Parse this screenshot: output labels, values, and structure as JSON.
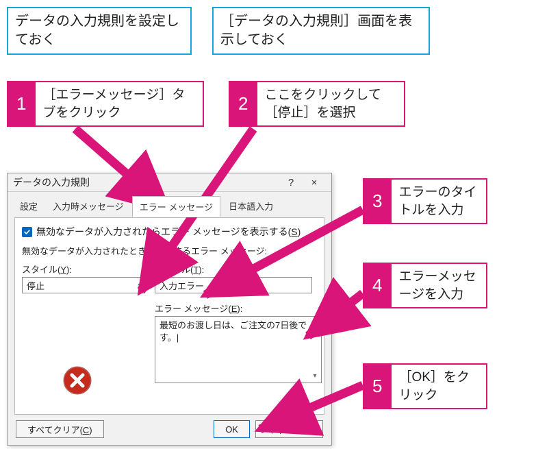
{
  "intro": {
    "box1": "データの入力規則を設定しておく",
    "box2": "［データの入力規則］画面を表示しておく"
  },
  "steps": {
    "s1": {
      "num": "1",
      "text": "［エラーメッセージ］タブをクリック"
    },
    "s2": {
      "num": "2",
      "text": "ここをクリックして［停止］を選択"
    },
    "s3": {
      "num": "3",
      "text": "エラーのタイトルを入力"
    },
    "s4": {
      "num": "4",
      "text": "エラーメッセージを入力"
    },
    "s5": {
      "num": "5",
      "text": "［OK］をクリック"
    }
  },
  "dialog": {
    "title": "データの入力規則",
    "help": "?",
    "close": "×",
    "tabs": {
      "settings": "設定",
      "input_msg": "入力時メッセージ",
      "error_msg": "エラー メッセージ",
      "ime": "日本語入力"
    },
    "checkbox_label_prefix": "無効なデータが入力されたらエラー メッセージを表示する(",
    "checkbox_accel": "S",
    "checkbox_label_suffix": ")",
    "sublabel": "無効なデータが入力されたときに表示するエラー メッセージ:",
    "style_label_prefix": "スタイル(",
    "style_accel": "Y",
    "style_label_suffix": "):",
    "style_value": "停止",
    "title_label_prefix": "タイトル(",
    "title_accel": "T",
    "title_label_suffix": "):",
    "title_value": "入力エラー",
    "msg_label_prefix": "エラー メッセージ(",
    "msg_accel": "E",
    "msg_label_suffix": "):",
    "msg_value": "最短のお渡し日は、ご注文の7日後です。|",
    "clear_prefix": "すべてクリア(",
    "clear_accel": "C",
    "clear_suffix": ")",
    "ok": "OK",
    "cancel": "キャンセル"
  }
}
